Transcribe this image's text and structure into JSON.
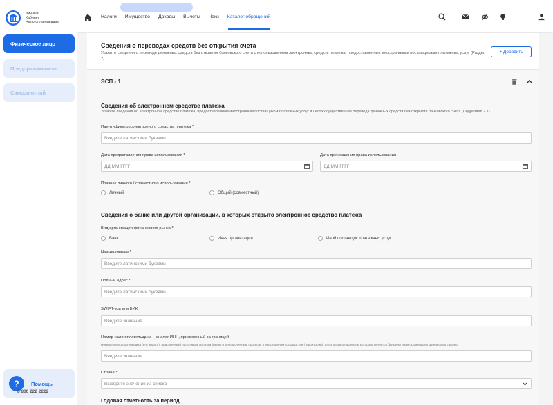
{
  "logo": {
    "line1": "Личный",
    "line2": "Кабинет",
    "line3": "Налогоплательщика"
  },
  "sidebar": {
    "items": [
      {
        "label": "Физическое лицо"
      },
      {
        "label": "Предприниматель"
      },
      {
        "label": "Самозанятый"
      }
    ],
    "help": {
      "title": "Помощь",
      "phone": "8 800 222 2222"
    }
  },
  "topnav": {
    "items": [
      "Налоги",
      "Имущество",
      "Доходы",
      "Вычеты",
      "Чеки",
      "Каталог обращений"
    ]
  },
  "section": {
    "title": "Сведения о переводах средств без открытия счета",
    "desc": "Укажите сведения о переводе денежных средств без открытия банковского счета с использованием электронных средств платежа, предоставленных иностранными поставщиками платежных услуг (Раздел 2)",
    "add_label": "+ Добавить"
  },
  "esp": {
    "title": "ЭСП - 1",
    "instrument": {
      "title": "Сведения об электронном средстве платежа",
      "desc": "Укажите сведения об электронном средстве платежа, предоставленном иностранным поставщиком платежных услуг в целях осуществления перевода денежных средств без открытия банковского счёта (Подраздел 2.1)",
      "id_label": "Идентификатор электронного средства платежа *",
      "id_placeholder": "Введите латинскими буквами",
      "date_from_label": "Дата предоставления права использования *",
      "date_to_label": "Дата прекращения права использования",
      "date_placeholder": "ДД.ММ.ГГГГ",
      "usage_label": "Признак личного / совместного использования *",
      "usage_options": [
        "Личный",
        "Общий (совместный)"
      ]
    },
    "bank": {
      "title": "Сведения о банке или другой организации, в которых открыто электронное средство платежа",
      "org_type_label": "Вид организации финансового рынка *",
      "org_types": [
        "Банк",
        "Иная организация",
        "Иной поставщик платежных услуг"
      ],
      "name_label": "Наименование *",
      "name_placeholder": "Введите латинскими буквами",
      "address_label": "Полный адрес *",
      "address_placeholder": "Введите латинскими буквами",
      "swift_label": "SWIFT-код или БИК",
      "swift_placeholder": "Введите значение",
      "tin_label": "Номер налогоплательщика – аналог ИНН, присвоенный за границей",
      "tin_desc": "Номер налогоплательщика (его аналог), присвоенный налоговым органом (иным уполномоченным органом) в иностранном государстве (территории), налоговым резидентом которого является банк или иная организация финансового рынка",
      "tin_placeholder": "Введите значение",
      "country_label": "Страна *",
      "country_placeholder": "Выберите значение из списка"
    },
    "annual_title": "Годовая отчетность за период"
  },
  "colors": {
    "accent": "#1e6be6",
    "accent_light": "#e6eefc"
  }
}
